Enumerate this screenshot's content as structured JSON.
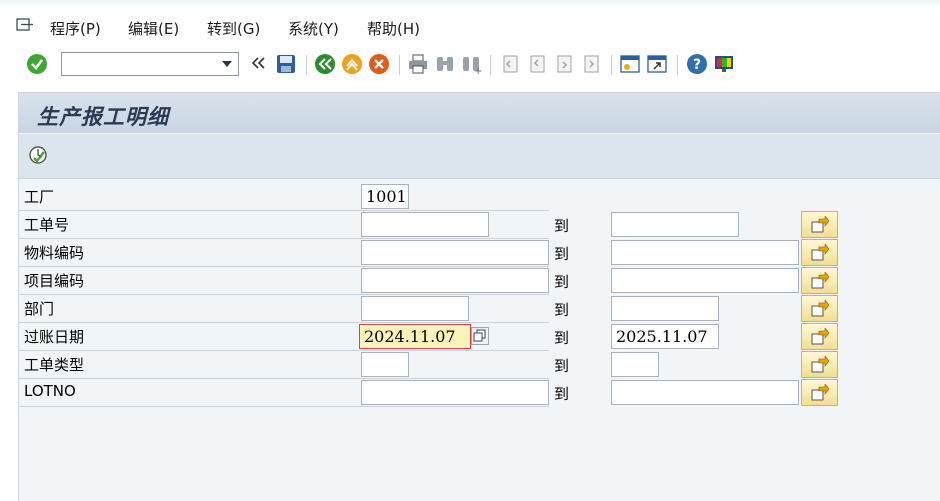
{
  "menu": {
    "items": [
      "程序(P)",
      "编辑(E)",
      "转到(G)",
      "系统(Y)",
      "帮助(H)"
    ]
  },
  "toolbar": {
    "command_value": ""
  },
  "page": {
    "title": "生产报工明细"
  },
  "form": {
    "to_label": "到",
    "rows": [
      {
        "label": "工厂",
        "low": "1001",
        "high": null
      },
      {
        "label": "工单号",
        "low": "",
        "high": ""
      },
      {
        "label": "物料编码",
        "low": "",
        "high": ""
      },
      {
        "label": "项目编码",
        "low": "",
        "high": ""
      },
      {
        "label": "部门",
        "low": "",
        "high": ""
      },
      {
        "label": "过账日期",
        "low": "2024.11.07",
        "high": "2025.11.07"
      },
      {
        "label": "工单类型",
        "low": "",
        "high": ""
      },
      {
        "label": "LOTNO",
        "low": "",
        "high": ""
      }
    ]
  },
  "colors": {
    "panel_bg": "#f2f5f8",
    "title_band": "#d9e2ec",
    "focus_field": "#fdf3b8",
    "check_green": "#3fa535"
  },
  "icons": [
    "menu-icon",
    "enter-check-icon",
    "back-icon",
    "save-icon",
    "back-green-icon",
    "exit-icon",
    "cancel-icon",
    "print-icon",
    "find-icon",
    "find-next-icon",
    "first-page-icon",
    "prev-page-icon",
    "next-page-icon",
    "last-page-icon",
    "new-session-icon",
    "shortcut-icon",
    "help-icon",
    "customize-layout-icon",
    "execute-icon",
    "multiple-selection-icon",
    "value-help-icon"
  ]
}
